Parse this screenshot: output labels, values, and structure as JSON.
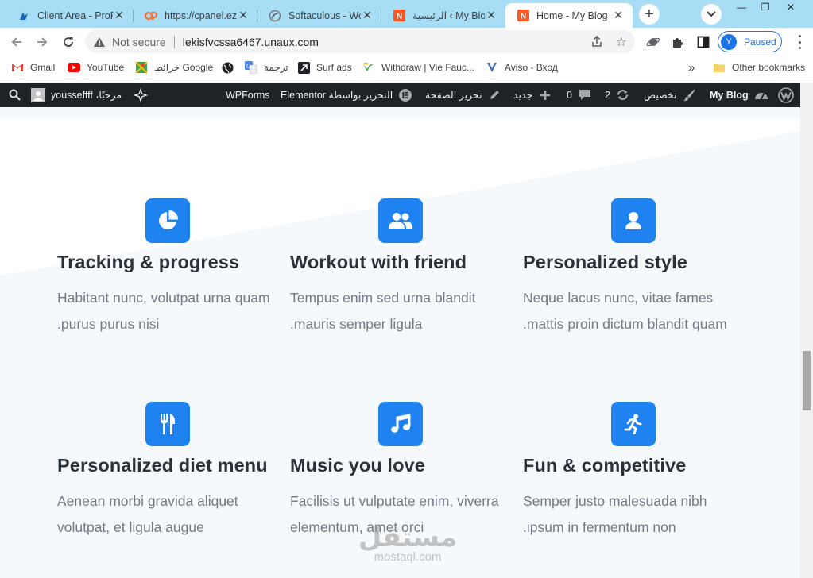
{
  "tabs": [
    {
      "title": "Client Area - ProFreeHost",
      "favicon": "profreehost-icon",
      "active": false
    },
    {
      "title": "https://cpanel.ezyro.com",
      "favicon": "cpanel-icon",
      "active": false
    },
    {
      "title": "Softaculous - WordPress",
      "favicon": "softaculous-icon",
      "active": false
    },
    {
      "title": "الرئيسية ‹ My Blog",
      "favicon": "wordpress-admin-icon",
      "active": false
    },
    {
      "title": "Home - My Blog",
      "favicon": "wordpress-admin-icon",
      "active": true
    }
  ],
  "window": {
    "minimize": "—",
    "restore": "❐",
    "close": "✕"
  },
  "addressbar": {
    "security_label": "Not secure",
    "url": "lekisfvcssa6467.unaux.com",
    "profile_initial": "Y",
    "profile_status": "Paused"
  },
  "bookmarks": [
    {
      "label": "Gmail",
      "icon": "gmail-icon"
    },
    {
      "label": "YouTube",
      "icon": "youtube-icon"
    },
    {
      "label": "خرائط Google",
      "icon": "google-maps-icon"
    },
    {
      "label": "",
      "icon": "globe-icon"
    },
    {
      "label": "ترجمة",
      "icon": "google-translate-icon"
    },
    {
      "label": "Surf ads",
      "icon": "surf-ads-icon"
    },
    {
      "label": "Withdraw | Vie Fauc...",
      "icon": "vie-faucet-icon"
    },
    {
      "label": "Aviso - Вход",
      "icon": "aviso-icon"
    }
  ],
  "bookmarks_overflow": "»",
  "other_bookmarks": "Other bookmarks",
  "wpbar": {
    "site_name": "My Blog",
    "customize": "تخصيص",
    "updates_count": "2",
    "comments_count": "0",
    "new_label": "جديد",
    "edit_page": "تحرير الصفحة",
    "edit_elementor": "التحرير بواسطة Elementor",
    "wpforms": "WPForms",
    "howdy": "مرحبًا، yousseffff"
  },
  "features": [
    {
      "title": "Tracking & progress",
      "desc_line1": "Habitant nunc, volutpat urna quam",
      "desc_line2": ".purus purus nisi",
      "icon": "pie-chart-icon"
    },
    {
      "title": "Workout with friend",
      "desc_line1": "Tempus enim sed urna blandit",
      "desc_line2": ".mauris semper ligula",
      "icon": "users-icon"
    },
    {
      "title": "Personalized style",
      "desc_line1": "Neque lacus nunc, vitae fames",
      "desc_line2": ".mattis proin dictum blandit quam",
      "icon": "user-icon"
    },
    {
      "title": "Personalized diet menu",
      "desc_line1": "Aenean morbi gravida aliquet",
      "desc_line2": "volutpat, et ligula augue",
      "icon": "utensils-icon"
    },
    {
      "title": "Music you love",
      "desc_line1": "Facilisis ut vulputate enim, viverra",
      "desc_line2": "elementum, amet orci",
      "icon": "music-note-icon"
    },
    {
      "title": "Fun & competitive",
      "desc_line1": "Semper justo malesuada nibh",
      "desc_line2": ".ipsum in fermentum non",
      "icon": "running-icon"
    }
  ],
  "watermark": {
    "arabic": "مستقل",
    "latin": "mostaql.com"
  },
  "colors": {
    "accent": "#1e82f0",
    "wpbar": "#1d2327",
    "tabstrip": "#a8ddf6",
    "section_bg": "#f6f9fc"
  }
}
